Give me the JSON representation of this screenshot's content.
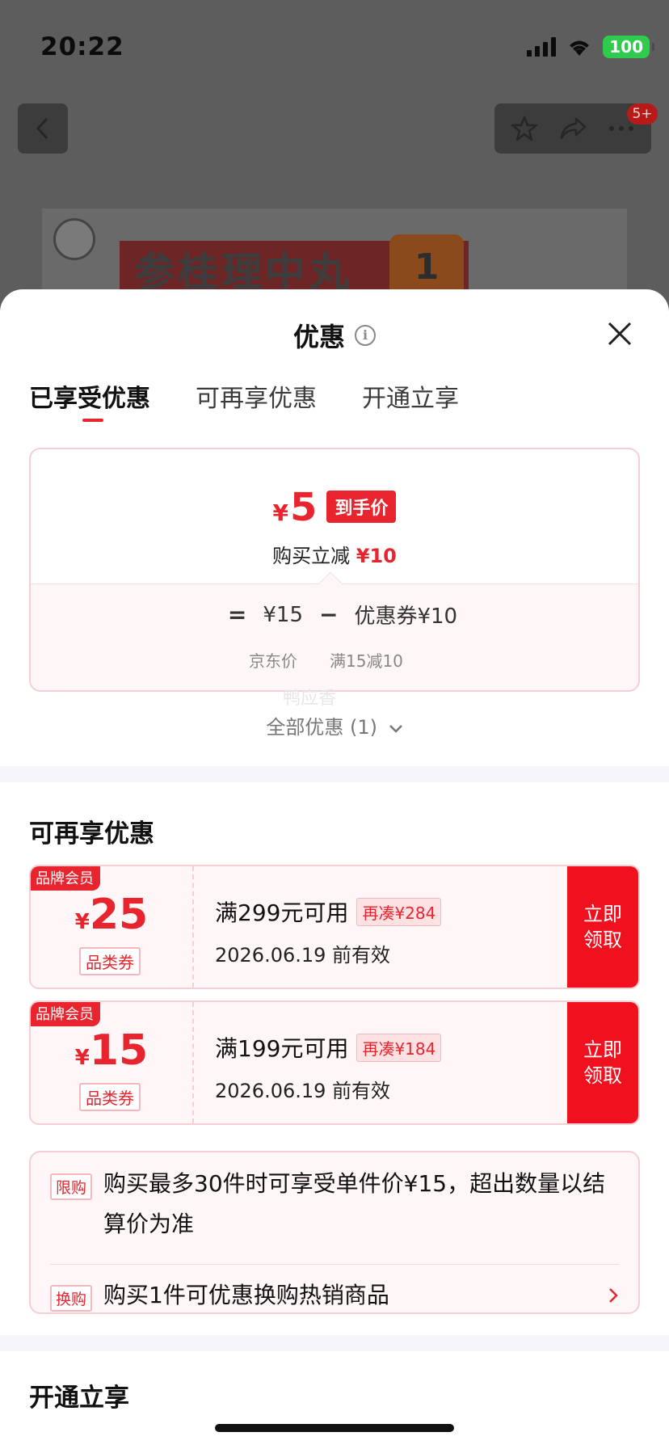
{
  "status_bar": {
    "time": "20:22",
    "battery": "100"
  },
  "background": {
    "notification_count": "5+",
    "product_title": "参桂理中丸",
    "product_badge": "1"
  },
  "sheet": {
    "title": "优惠",
    "tabs": [
      {
        "label": "已享受优惠"
      },
      {
        "label": "可再享优惠"
      },
      {
        "label": "开通立享"
      }
    ],
    "price_card": {
      "currency": "¥",
      "final_price": "5",
      "final_tag": "到手价",
      "discount_text": "购买立减",
      "discount_amount": "¥10",
      "eq": "=",
      "base_price": "¥15",
      "minus": "−",
      "coupon_text": "优惠券¥10",
      "base_label": "京东价",
      "coupon_label": "满15减10"
    },
    "watermark": "鸭应香",
    "all_promos": "全部优惠 (1)",
    "section_more": "可再享优惠",
    "coupons": [
      {
        "member_tag": "品牌会员",
        "currency": "¥",
        "amount": "25",
        "type": "品类券",
        "condition": "满299元可用",
        "more": "再凑¥284",
        "expiry": "2026.06.19 前有效",
        "button_line1": "立即",
        "button_line2": "领取"
      },
      {
        "member_tag": "品牌会员",
        "currency": "¥",
        "amount": "15",
        "type": "品类券",
        "condition": "满199元可用",
        "more": "再凑¥184",
        "expiry": "2026.06.19 前有效",
        "button_line1": "立即",
        "button_line2": "领取"
      }
    ],
    "limits": [
      {
        "tag": "限购",
        "text": "购买最多30件时可享受单件价¥15，超出数量以结算价为准"
      },
      {
        "tag": "换购",
        "text": "购买1件可优惠换购热销商品"
      }
    ],
    "section_open": "开通立享"
  },
  "colors": {
    "accent": "#e8242e",
    "coupon_button": "#f0101e",
    "battery": "#2fcb4c"
  }
}
